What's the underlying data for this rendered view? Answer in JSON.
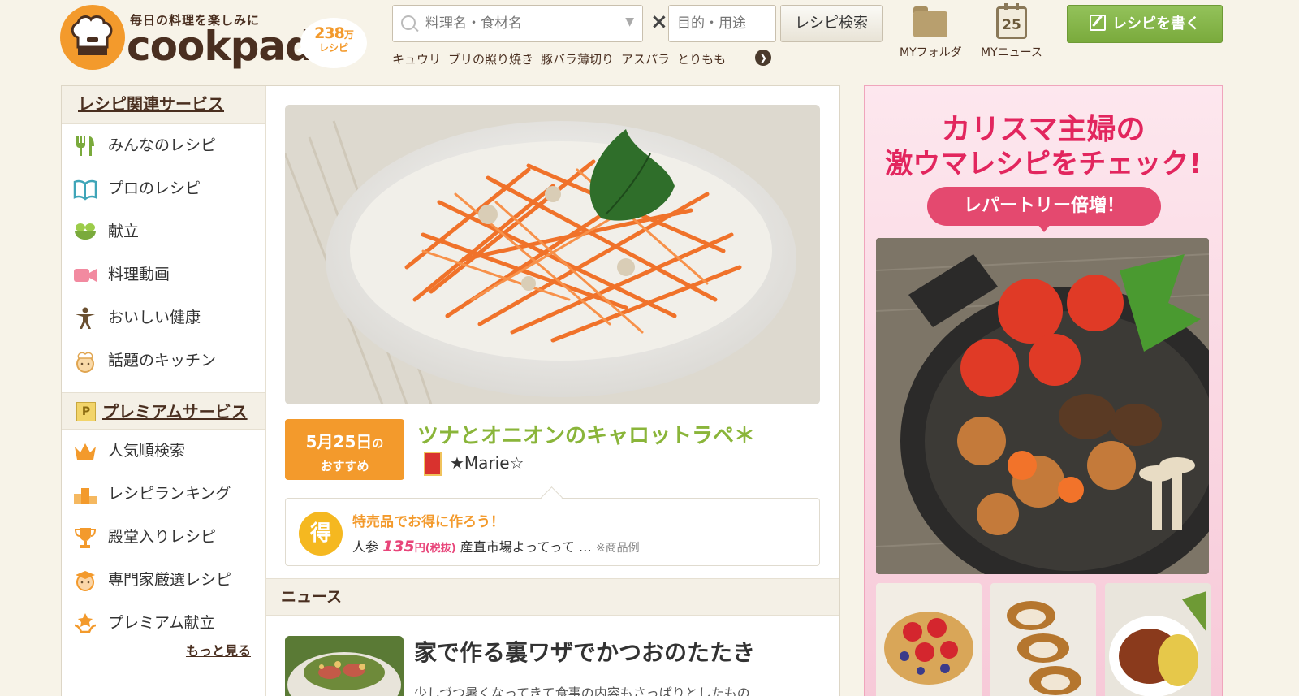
{
  "header": {
    "logo_tagline": "毎日の料理を楽しみに",
    "logo_word": "cookpad",
    "recipe_count": "238",
    "recipe_count_unit": "万",
    "recipe_count_label": "レシピ",
    "search": {
      "dish_placeholder": "料理名・食材名",
      "purpose_placeholder": "目的・用途",
      "times_symbol": "×",
      "button_label": "レシピ検索"
    },
    "keywords": [
      "キュウリ",
      "ブリの照り焼き",
      "豚バラ薄切り",
      "アスパラ",
      "とりもも"
    ],
    "my_folder_label": "MYフォルダ",
    "my_news_label": "MYニュース",
    "calendar_day": "25",
    "write_button_label": "レシピを書く"
  },
  "sidebar": {
    "section1_title": "レシピ関連サービス",
    "section1_items": [
      {
        "label": "みんなのレシピ",
        "icon": "fork-knife-icon"
      },
      {
        "label": "プロのレシピ",
        "icon": "open-book-icon"
      },
      {
        "label": "献立",
        "icon": "meal-set-icon"
      },
      {
        "label": "料理動画",
        "icon": "video-camera-icon"
      },
      {
        "label": "おいしい健康",
        "icon": "person-icon"
      },
      {
        "label": "話題のキッチン",
        "icon": "chef-face-icon"
      }
    ],
    "section2_badge": "P",
    "section2_title": "プレミアムサービス",
    "section2_items": [
      {
        "label": "人気順検索",
        "icon": "crown-icon"
      },
      {
        "label": "レシピランキング",
        "icon": "podium-icon"
      },
      {
        "label": "殿堂入りレシピ",
        "icon": "trophy-icon"
      },
      {
        "label": "専門家厳選レシピ",
        "icon": "expert-face-icon"
      },
      {
        "label": "プレミアム献立",
        "icon": "hands-star-icon"
      }
    ],
    "more_label": "もっと見る"
  },
  "featured": {
    "date_line": "5月25日",
    "date_suffix": "の",
    "recommend_label": "おすすめ",
    "title": "ツナとオニオンのキャロットラペ＊",
    "author": "★Marie☆"
  },
  "deal": {
    "badge": "得",
    "headline": "特売品でお得に作ろう！",
    "item": "人参",
    "price": "135",
    "price_unit": "円(税抜)",
    "store": "産直市場よってって …",
    "note": "※商品例"
  },
  "news": {
    "section_title": "ニュース",
    "item_title": "家で作る裏ワザでかつおのたたき",
    "item_snippet": "少しづつ暑くなってきて食事の内容もさっぱりとしたもの"
  },
  "ad": {
    "headline1": "カリスマ主婦の",
    "headline2": "激ウマレシピをチェック!",
    "pill": "レパートリー倍増！"
  },
  "colors": {
    "brand_orange": "#f39a2c",
    "brand_brown": "#4a2f20",
    "accent_green": "#8ab53a",
    "ad_pink": "#e2265e"
  }
}
